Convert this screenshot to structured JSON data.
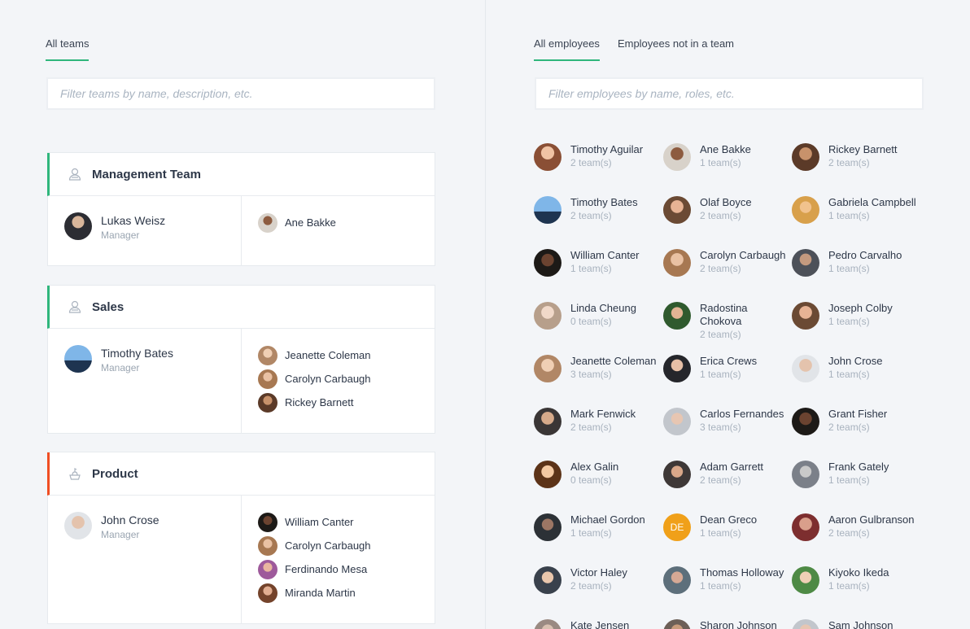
{
  "left": {
    "tabs": [
      {
        "label": "All teams",
        "active": true
      }
    ],
    "search_placeholder": "Filter teams by name, description, etc.",
    "teams": [
      {
        "name": "Management Team",
        "icon": "users-icon",
        "accent": "#2fb67c",
        "manager": {
          "name": "Lukas Weisz",
          "role": "Manager"
        },
        "members": [
          "Ane Bakke"
        ]
      },
      {
        "name": "Sales",
        "icon": "users-icon",
        "accent": "#2fb67c",
        "manager": {
          "name": "Timothy Bates",
          "role": "Manager"
        },
        "members": [
          "Jeanette Coleman",
          "Carolyn Carbaugh",
          "Rickey Barnett"
        ]
      },
      {
        "name": "Product",
        "icon": "product-icon",
        "accent": "#f04e23",
        "manager": {
          "name": "John Crose",
          "role": "Manager"
        },
        "members": [
          "William Canter",
          "Carolyn Carbaugh",
          "Ferdinando Mesa",
          "Miranda Martin"
        ]
      }
    ]
  },
  "right": {
    "tabs": [
      {
        "label": "All employees",
        "active": true
      },
      {
        "label": "Employees not in a team",
        "active": false
      }
    ],
    "search_placeholder": "Filter employees by name, roles, etc.",
    "employees": [
      {
        "name": "Timothy Aguilar",
        "teams": "2 team(s)"
      },
      {
        "name": "Ane Bakke",
        "teams": "1 team(s)"
      },
      {
        "name": "Rickey Barnett",
        "teams": "2 team(s)"
      },
      {
        "name": "Timothy Bates",
        "teams": "2 team(s)"
      },
      {
        "name": "Olaf Boyce",
        "teams": "2 team(s)"
      },
      {
        "name": "Gabriela Campbell",
        "teams": "1 team(s)"
      },
      {
        "name": "William Canter",
        "teams": "1 team(s)"
      },
      {
        "name": "Carolyn Carbaugh",
        "teams": "2 team(s)"
      },
      {
        "name": "Pedro Carvalho",
        "teams": "1 team(s)"
      },
      {
        "name": "Linda Cheung",
        "teams": "0 team(s)"
      },
      {
        "name": "Radostina Chokova",
        "teams": "2 team(s)"
      },
      {
        "name": "Joseph Colby",
        "teams": "1 team(s)"
      },
      {
        "name": "Jeanette Coleman",
        "teams": "3 team(s)"
      },
      {
        "name": "Erica Crews",
        "teams": "1 team(s)"
      },
      {
        "name": "John Crose",
        "teams": "1 team(s)"
      },
      {
        "name": "Mark Fenwick",
        "teams": "2 team(s)"
      },
      {
        "name": "Carlos Fernandes",
        "teams": "3 team(s)"
      },
      {
        "name": "Grant Fisher",
        "teams": "2 team(s)"
      },
      {
        "name": "Alex Galin",
        "teams": "0 team(s)"
      },
      {
        "name": "Adam Garrett",
        "teams": "2 team(s)"
      },
      {
        "name": "Frank Gately",
        "teams": "1 team(s)"
      },
      {
        "name": "Michael Gordon",
        "teams": "1 team(s)"
      },
      {
        "name": "Dean Greco",
        "teams": "1 team(s)",
        "initials": "DE"
      },
      {
        "name": "Aaron Gulbranson",
        "teams": "2 team(s)"
      },
      {
        "name": "Victor Haley",
        "teams": "2 team(s)"
      },
      {
        "name": "Thomas Holloway",
        "teams": "1 team(s)"
      },
      {
        "name": "Kiyoko Ikeda",
        "teams": "1 team(s)"
      },
      {
        "name": "Kate Jensen",
        "teams": ""
      },
      {
        "name": "Sharon Johnson",
        "teams": ""
      },
      {
        "name": "Sam Johnson",
        "teams": ""
      }
    ]
  }
}
